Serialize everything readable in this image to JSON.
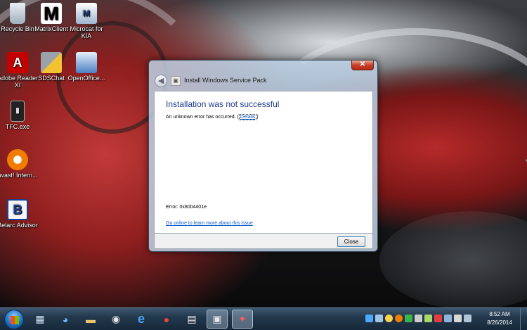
{
  "desktop": {
    "icons": [
      {
        "label": "Recycle Bin",
        "icon": "recycle-bin-icon"
      },
      {
        "label": "MatrixClient",
        "icon": "matrix-client-icon"
      },
      {
        "label": "Microcat for KIA",
        "icon": "microcat-icon"
      },
      {
        "label": "Adobe Reader XI",
        "icon": "adobe-reader-icon"
      },
      {
        "label": "SDSChat",
        "icon": "sdschat-icon"
      },
      {
        "label": "OpenOffice...",
        "icon": "openoffice-icon"
      },
      {
        "label": "TFC.exe",
        "icon": "tfc-icon"
      },
      {
        "label": "avast! Intern...",
        "icon": "avast-icon"
      },
      {
        "label": "Belarc Advisor",
        "icon": "belarc-icon"
      }
    ]
  },
  "window": {
    "title": "Install Windows Service Pack",
    "close_glyph": "✕",
    "heading": "Installation was not successful",
    "message": "An unknown error has occurred.",
    "details_link": "Details",
    "error_code": "Error: 0x8004401e",
    "online_link": "Go online to learn more about this issue",
    "close_button": "Close"
  },
  "taskbar": {
    "pinned": [
      {
        "icon": "calculator-icon",
        "glyph": "▦",
        "active": false
      },
      {
        "icon": "network-globe-icon",
        "glyph": "◕",
        "active": false
      },
      {
        "icon": "car-app-icon",
        "glyph": "▬",
        "active": false
      },
      {
        "icon": "media-disc-icon",
        "glyph": "◉",
        "active": false
      },
      {
        "icon": "internet-explorer-icon",
        "glyph": "e",
        "active": false
      },
      {
        "icon": "chrome-icon",
        "glyph": "●",
        "active": false
      },
      {
        "icon": "calendar-icon",
        "glyph": "▤",
        "active": false
      },
      {
        "icon": "installer-icon",
        "glyph": "▣",
        "active": true
      },
      {
        "icon": "tool-app-icon",
        "glyph": "✦",
        "active": true
      }
    ],
    "clock_time": "8:52 AM",
    "clock_date": "8/26/2014",
    "colors": {
      "accent": "#1e3c8c",
      "link": "#0a58ca"
    }
  }
}
